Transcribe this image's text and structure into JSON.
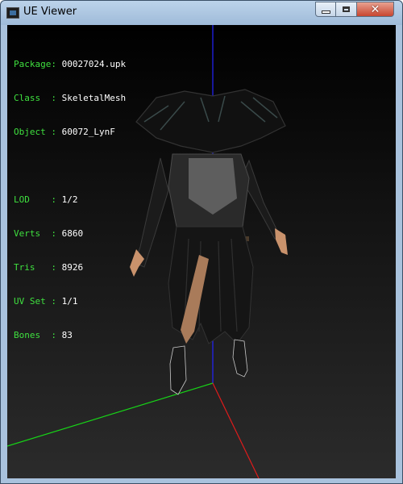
{
  "window": {
    "title": "UE Viewer"
  },
  "info": {
    "rows": [
      {
        "label": "Package",
        "sep": ": ",
        "value": "00027024.upk"
      },
      {
        "label": "Class  ",
        "sep": ": ",
        "value": "SkeletalMesh"
      },
      {
        "label": "Object ",
        "sep": ": ",
        "value": "60072_LynF"
      },
      {
        "label": "",
        "sep": "",
        "value": ""
      },
      {
        "label": "LOD    ",
        "sep": ": ",
        "value": "1/2"
      },
      {
        "label": "Verts  ",
        "sep": ": ",
        "value": "6860"
      },
      {
        "label": "Tris   ",
        "sep": ": ",
        "value": "8926"
      },
      {
        "label": "UV Set ",
        "sep": ": ",
        "value": "1/1"
      },
      {
        "label": "Bones  ",
        "sep": ": ",
        "value": "83"
      }
    ]
  },
  "colors": {
    "info_label": "#3fe03f",
    "info_value": "#ffffff",
    "axis_x": "#e01b1b",
    "axis_y": "#17d417",
    "axis_z": "#2323ff"
  },
  "icons": {
    "app": "app-icon",
    "minimize": "minimize-icon",
    "maximize": "maximize-icon",
    "close": "close-icon"
  }
}
